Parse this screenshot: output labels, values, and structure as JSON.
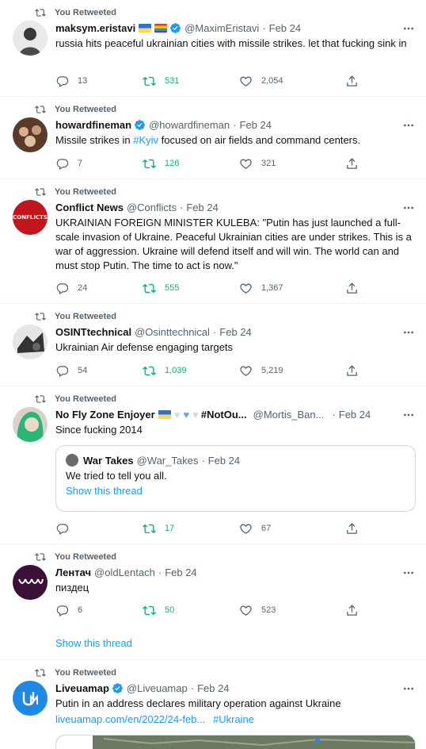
{
  "retweet_label": "You Retweeted",
  "tweets": [
    {
      "name": "maksym.eristavi",
      "handle": "@MaximEristavi",
      "date": "Feb 24",
      "text": "russia hits peaceful ukrainian cities with missile strikes. let that fucking sink in",
      "reply_count": "13",
      "retweet_count": "531",
      "like_count": "2,054"
    },
    {
      "name": "howardfineman",
      "handle": "@howardfineman",
      "date": "Feb 24",
      "text_before": "Missile strikes in ",
      "text_link": "#Kyiv",
      "text_after": " focused on air fields and command centers.",
      "reply_count": "7",
      "retweet_count": "126",
      "like_count": "321"
    },
    {
      "name": "Conflict News",
      "handle": "@Conflicts",
      "date": "Feb 24",
      "avatar_label": "CONFLICTS",
      "text": "UKRAINIAN FOREIGN MINISTER KULEBA: \"Putin has just launched a full-scale invasion of Ukraine. Peaceful Ukrainian cities are under strikes. This is a war of aggression. Ukraine will defend itself and will win. The world can and must stop Putin. The time to act is now.\"",
      "reply_count": "24",
      "retweet_count": "555",
      "like_count": "1,367"
    },
    {
      "name": "OSINTtechnical",
      "handle": "@Osinttechnical",
      "date": "Feb 24",
      "text": "Ukrainian Air defense engaging targets",
      "reply_count": "54",
      "retweet_count": "1,039",
      "like_count": "5,219"
    },
    {
      "name": "No Fly Zone Enjoyer",
      "name_suffix": "#NotOu...",
      "handle": "@Mortis_Ban...",
      "date": "Feb 24",
      "text": "Since fucking 2014",
      "quote": {
        "name": "War Takes",
        "handle": "@War_Takes",
        "date": "Feb 24",
        "text": "We tried to tell you all.",
        "show_thread": "Show this thread"
      },
      "retweet_count": "17",
      "like_count": "67"
    },
    {
      "name": "Лентач",
      "handle": "@oldLentach",
      "date": "Feb 24",
      "text": "пиздец",
      "reply_count": "6",
      "retweet_count": "50",
      "like_count": "523",
      "show_thread": "Show this thread"
    },
    {
      "name": "Liveuamap",
      "handle": "@Liveuamap",
      "date": "Feb 24",
      "text": "Putin in an address declares military operation against Ukraine",
      "link_url": "liveuamap.com/en/2022/24-feb...",
      "link_tag": "#Ukraine"
    }
  ],
  "colors": {
    "accent": "#1d9bf0",
    "retweeted": "#00ba7c",
    "muted": "#536471",
    "verified": "#1d9bf0"
  },
  "icons": [
    "retweet-icon",
    "verified-icon",
    "more-icon",
    "reply-icon",
    "heart-icon",
    "share-icon"
  ]
}
